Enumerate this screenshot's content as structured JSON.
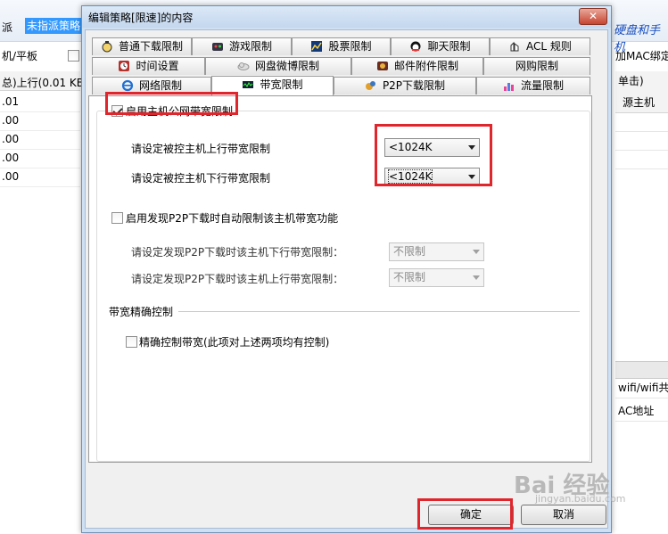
{
  "background": {
    "label_dispatch": "派",
    "combo_value": "未指派策略",
    "tablet_label": "机/平板",
    "right_text": "硬盘和手机",
    "right_mac": "加MAC绑定",
    "table_header": "总)上行(0.01 KB",
    "rows": [
      ".01",
      ".00",
      ".00",
      ".00",
      ".00"
    ],
    "right_col_header_top": "单击)",
    "right_col_header": "源主机",
    "right_wifi": "wifi/wifi共享",
    "right_mac_addr": "AC地址"
  },
  "dialog": {
    "title": "编辑策略[限速]的内容",
    "close_label": "✕",
    "tabs_row1": [
      {
        "label": "普通下载限制",
        "icon": "download-bell-icon"
      },
      {
        "label": "游戏限制",
        "icon": "game-icon"
      },
      {
        "label": "股票限制",
        "icon": "stock-icon"
      },
      {
        "label": "聊天限制",
        "icon": "chat-icon"
      },
      {
        "label": "ACL 规则",
        "icon": "acl-icon"
      }
    ],
    "tabs_row2": [
      {
        "label": "时间设置",
        "icon": "clock-icon"
      },
      {
        "label": "网盘微博限制",
        "icon": "cloud-icon"
      },
      {
        "label": "邮件附件限制",
        "icon": "mail-icon"
      },
      {
        "label": "网购限制",
        "icon": ""
      }
    ],
    "tabs_row3": [
      {
        "label": "网络限制",
        "icon": "ie-icon"
      },
      {
        "label": "带宽限制",
        "icon": "bandwidth-icon"
      },
      {
        "label": "P2P下载限制",
        "icon": "p2p-icon"
      },
      {
        "label": "流量限制",
        "icon": "traffic-icon"
      }
    ],
    "enable_public_limit": "启用主机公网带宽限制",
    "upload_label": "请设定被控主机上行带宽限制",
    "upload_value": "<1024K",
    "download_label": "请设定被控主机下行带宽限制",
    "download_value": "<1024K",
    "p2p_auto_label": "启用发现P2P下载时自动限制该主机带宽功能",
    "p2p_down_label": "请设定发现P2P下载时该主机下行带宽限制：",
    "p2p_down_value": "不限制",
    "p2p_up_label": "请设定发现P2P下载时该主机上行带宽限制：",
    "p2p_up_value": "不限制",
    "precise_group": "带宽精确控制",
    "precise_label": "精确控制带宽(此项对上述两项均有控制)",
    "ok_label": "确定",
    "cancel_label": "取消"
  },
  "watermark": {
    "text": "Bai 经验",
    "sub": "jingyan.baidu.com"
  },
  "colors": {
    "highlight_red": "#e0262d",
    "dialog_frame": "#cfe0f3",
    "selection_blue": "#3399ff"
  }
}
